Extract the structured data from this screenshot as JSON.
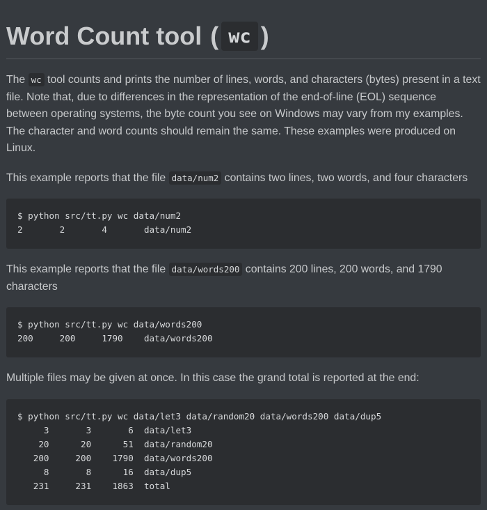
{
  "heading": {
    "prefix": "Word Count tool",
    "open_paren": "(",
    "code": "wc",
    "close_paren": ")"
  },
  "intro": {
    "before_code": "The ",
    "code": "wc",
    "after_code": " tool counts and prints the number of lines, words, and characters (bytes) present in a text file. Note that, due to differences in the representation of the end-of-line (EOL) sequence between operating systems, the byte count you see on Windows may vary from my examples. The character and word counts should remain the same. These examples were produced on Linux."
  },
  "example1": {
    "before_code": "This example reports that the file ",
    "code": "data/num2",
    "after_code": " contains two lines, two words, and four characters",
    "output": "$ python src/tt.py wc data/num2\n2       2       4       data/num2"
  },
  "example2": {
    "before_code": "This example reports that the file ",
    "code": "data/words200",
    "after_code": " contains 200 lines, 200 words, and 1790 characters",
    "output": "$ python src/tt.py wc data/words200\n200     200     1790    data/words200"
  },
  "example3": {
    "text": "Multiple files may be given at once. In this case the grand total is reported at the end:",
    "output": "$ python src/tt.py wc data/let3 data/random20 data/words200 data/dup5\n     3       3       6  data/let3\n    20      20      51  data/random20\n   200     200    1790  data/words200\n     8       8      16  data/dup5\n   231     231    1863  total"
  }
}
